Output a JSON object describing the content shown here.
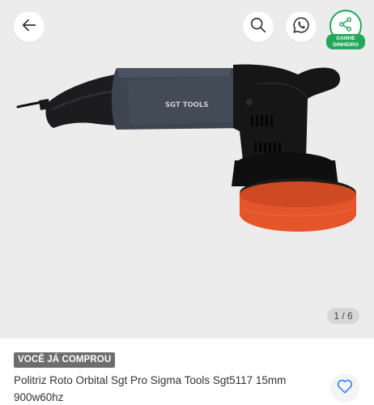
{
  "gallery": {
    "page_counter": "1 / 6",
    "current_page": 1,
    "total_pages": 6,
    "product_brand_text": "SGT TOOLS"
  },
  "header": {
    "back_icon": "arrow-left-icon",
    "search_icon": "search-icon",
    "whatsapp_icon": "whatsapp-icon",
    "share_icon": "share-icon",
    "share_badge": "Ganhe\nDinheiro"
  },
  "product": {
    "purchased_badge": "VOCÊ JÁ COMPROU",
    "title": "Politriz Roto Orbital Sgt Pro Sigma Tools Sgt5117 15mm 900w60hz",
    "favorite_icon": "heart-outline-icon"
  },
  "colors": {
    "accent_green": "#23a85b",
    "favorite_blue": "#3483fa",
    "badge_gray": "#6d6d6d"
  }
}
